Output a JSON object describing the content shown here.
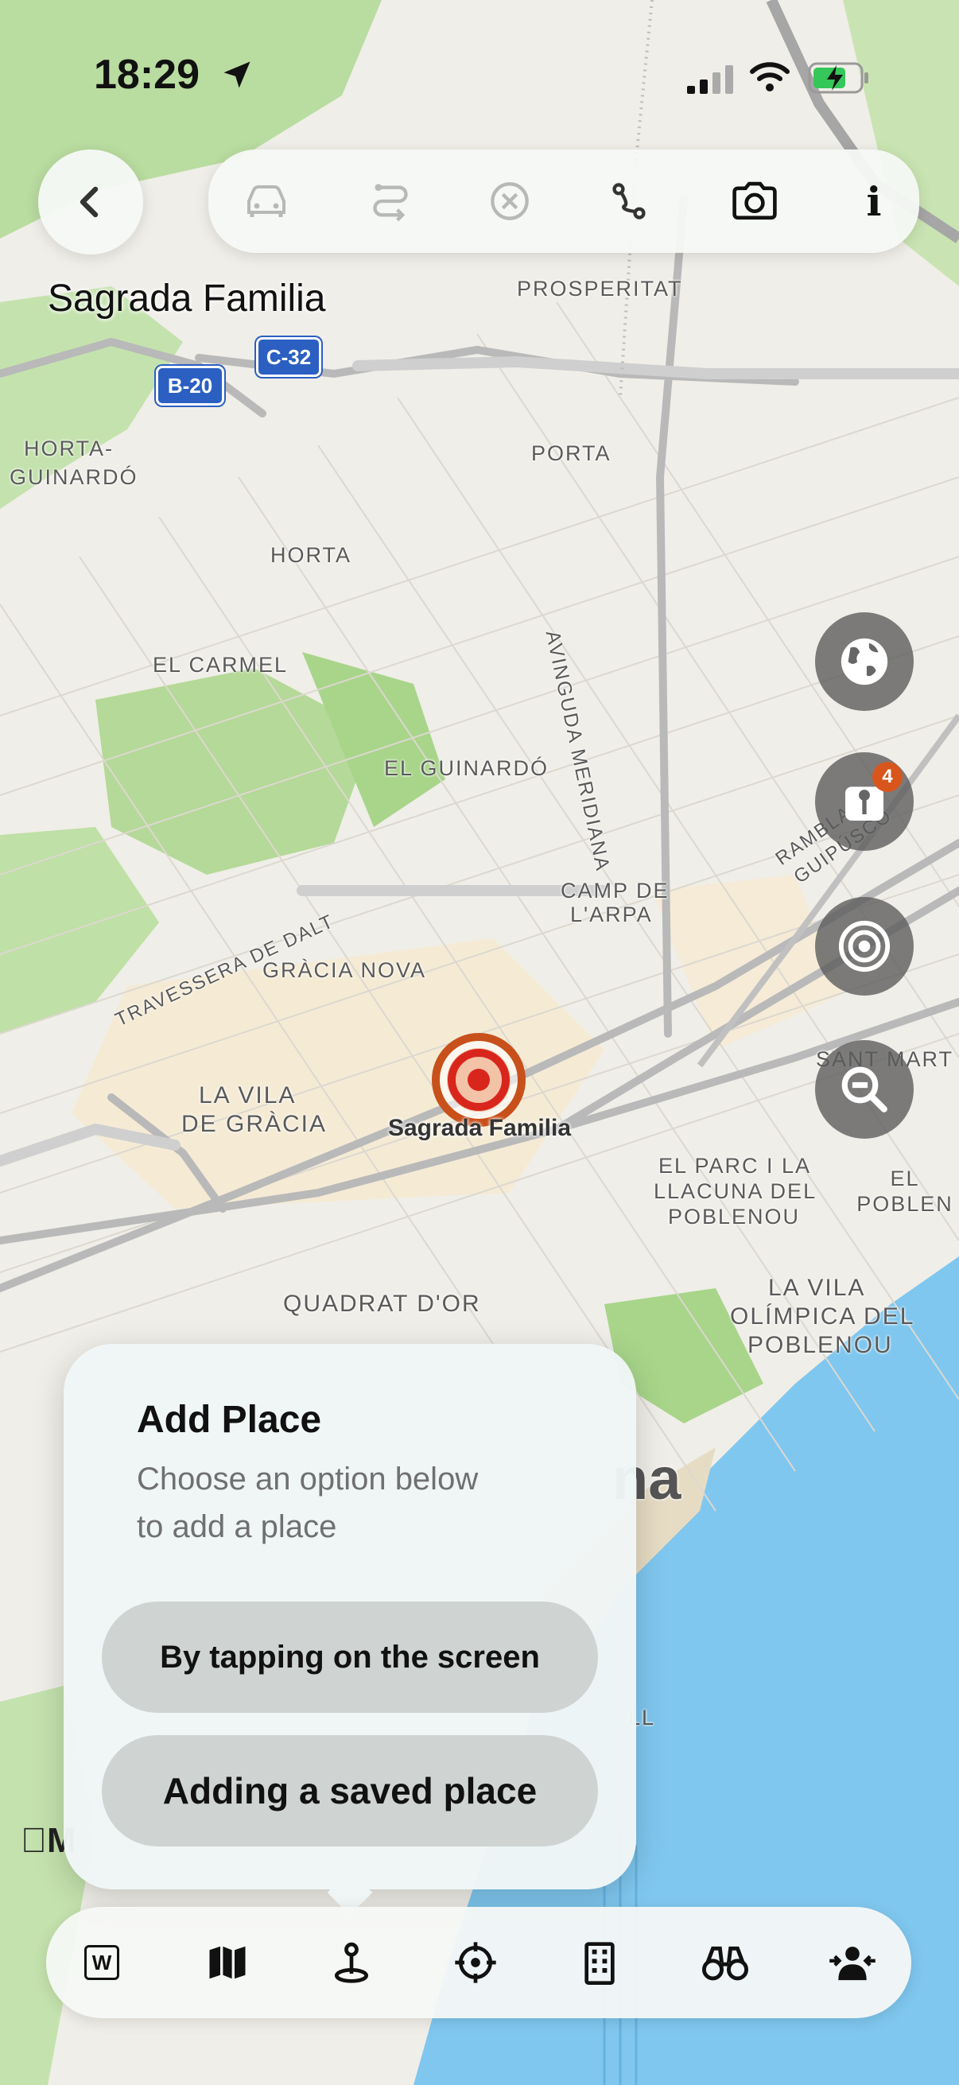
{
  "status_bar": {
    "time": "18:29"
  },
  "toolbar": {
    "back_icon": "chevron-left-icon",
    "buttons": [
      "car-icon",
      "route-switch-icon",
      "close-circle-icon",
      "route-icon",
      "camera-icon",
      "info-icon"
    ],
    "info_label": "i"
  },
  "place_title": "Sagrada Familia",
  "map": {
    "shields": {
      "b20": "B-20",
      "c32": "C-32"
    },
    "labels": {
      "prosperitat": "PROSPERITAT",
      "horta_guinardo_1": "HORTA-",
      "horta_guinardo_2": "GUINARDÓ",
      "porta": "PORTA",
      "horta": "HORTA",
      "avinguda_meridiana": "AVINGUDA MERIDIANA",
      "el_carmel": "EL CARMEL",
      "el_guinardo": "EL GUINARDÓ",
      "rambla_guipuscoa": "RAMBLA DE GUIPÚSCO",
      "travessera_de_dalt": "TRAVESSERA DE DALT",
      "camp_de_larpa_1": "CAMP DE",
      "camp_de_larpa_2": "L'ARPA",
      "gracia_nova": "GRÀCIA NOVA",
      "sant_marti": "SANT MART",
      "la_vila_de_gracia_1": "LA VILA",
      "la_vila_de_gracia_2": "DE GRÀCIA",
      "sagrada_familia_marker": "Sagrada Familia",
      "el_parc_1": "EL PARC I LA",
      "el_parc_2": "LLACUNA DEL",
      "el_parc_3": "POBLENOU",
      "el_poblenou": "EL POBLEN",
      "quadrat_dor": "QUADRAT D'OR",
      "vila_olimpica_1": "LA VILA",
      "vila_olimpica_2": "OLÍMPICA DEL",
      "vila_olimpica_3": "POBLENOU",
      "barcelona_partial": "na",
      "ll_partial": "LL",
      "apple_maps_partial": "M"
    },
    "colors": {
      "marker": "#d9261c",
      "marker_ring": "#c8501a",
      "water": "#7fc7ef",
      "park": "#a8d58a"
    }
  },
  "side_buttons": {
    "globe": "globe-icon",
    "saved_places_badge": "4",
    "target": "target-icon",
    "zoom_out": "zoom-out-icon"
  },
  "popup": {
    "title": "Add Place",
    "subtitle_line1": "Choose an option below",
    "subtitle_line2": "to add a place",
    "option1": "By tapping on the screen",
    "option2": "Adding a saved place"
  },
  "tab_bar": {
    "items": [
      "wikipedia-icon",
      "map-icon",
      "add-place-pin-icon",
      "crosshair-icon",
      "building-icon",
      "binoculars-icon",
      "person-share-icon"
    ],
    "wiki_letter": "W"
  }
}
